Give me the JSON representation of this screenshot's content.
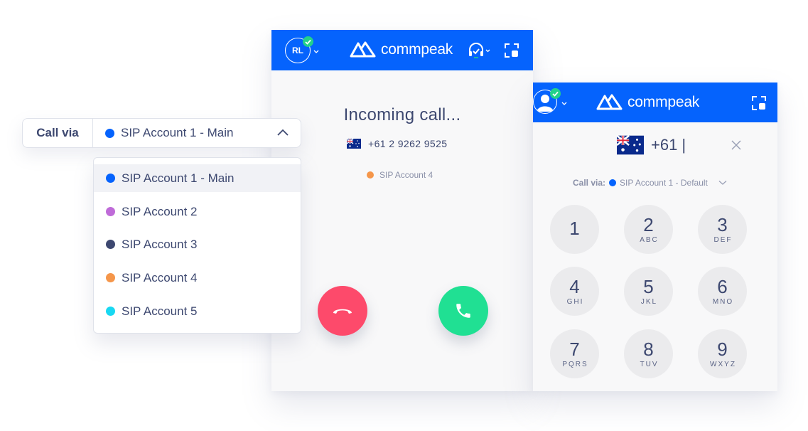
{
  "brand": {
    "name": "commpeak",
    "primary_color": "#0563fd",
    "status_color": "#23d18b"
  },
  "call_via_select": {
    "label": "Call via",
    "selected": "SIP Account 1 - Main",
    "selected_color": "#0563fd",
    "expanded": true,
    "options": [
      {
        "label": "SIP Account 1 - Main",
        "color": "#0563fd",
        "selected": true
      },
      {
        "label": "SIP Account 2",
        "color": "#bf6bd8",
        "selected": false
      },
      {
        "label": "SIP Account 3",
        "color": "#3d4870",
        "selected": false
      },
      {
        "label": "SIP Account 4",
        "color": "#f5964a",
        "selected": false
      },
      {
        "label": "SIP Account 5",
        "color": "#18d8f2",
        "selected": false
      }
    ]
  },
  "incoming_panel": {
    "user_initials": "RL",
    "title": "Incoming call...",
    "caller_number": "+61 2 9262 9525",
    "caller_country": "Australia",
    "account_label": "SIP Account 4",
    "account_color": "#f5964a",
    "decline_color": "#fd4a6b",
    "accept_color": "#20e093"
  },
  "dialer_panel": {
    "number_input": "+61 |",
    "country": "Australia",
    "call_via_label": "Call via:",
    "call_via_value": "SIP Account 1 - Default",
    "call_via_color": "#0563fd",
    "keys": [
      {
        "digit": "1",
        "letters": ""
      },
      {
        "digit": "2",
        "letters": "ABC"
      },
      {
        "digit": "3",
        "letters": "DEF"
      },
      {
        "digit": "4",
        "letters": "GHI"
      },
      {
        "digit": "5",
        "letters": "JKL"
      },
      {
        "digit": "6",
        "letters": "MNO"
      },
      {
        "digit": "7",
        "letters": "PQRS"
      },
      {
        "digit": "8",
        "letters": "TUV"
      },
      {
        "digit": "9",
        "letters": "WXYZ"
      }
    ]
  }
}
